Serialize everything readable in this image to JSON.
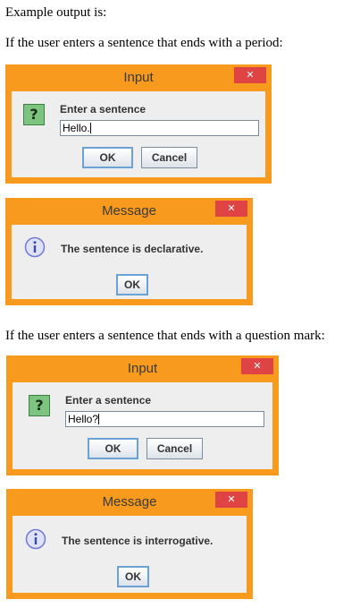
{
  "intro": "Example output is:",
  "case_period": "If the user enters a sentence that ends with a period:",
  "case_question": "If the user enters a sentence that ends with a question mark:",
  "dialogs": {
    "input1": {
      "title": "Input",
      "close": "✕",
      "prompt": "Enter a sentence",
      "value": "Hello.",
      "ok": "OK",
      "cancel": "Cancel",
      "icon": "question-icon"
    },
    "message1": {
      "title": "Message",
      "close": "✕",
      "text": "The sentence is declarative.",
      "ok": "OK",
      "icon": "info-icon"
    },
    "input2": {
      "title": "Input",
      "close": "✕",
      "prompt": "Enter a sentence",
      "value": "Hello?",
      "ok": "OK",
      "cancel": "Cancel",
      "icon": "question-icon"
    },
    "message2": {
      "title": "Message",
      "close": "✕",
      "text": "The sentence is interrogative.",
      "ok": "OK",
      "icon": "info-icon"
    }
  },
  "colors": {
    "frame": "#f79a1d",
    "close": "#e04343",
    "body": "#eeeeee"
  }
}
